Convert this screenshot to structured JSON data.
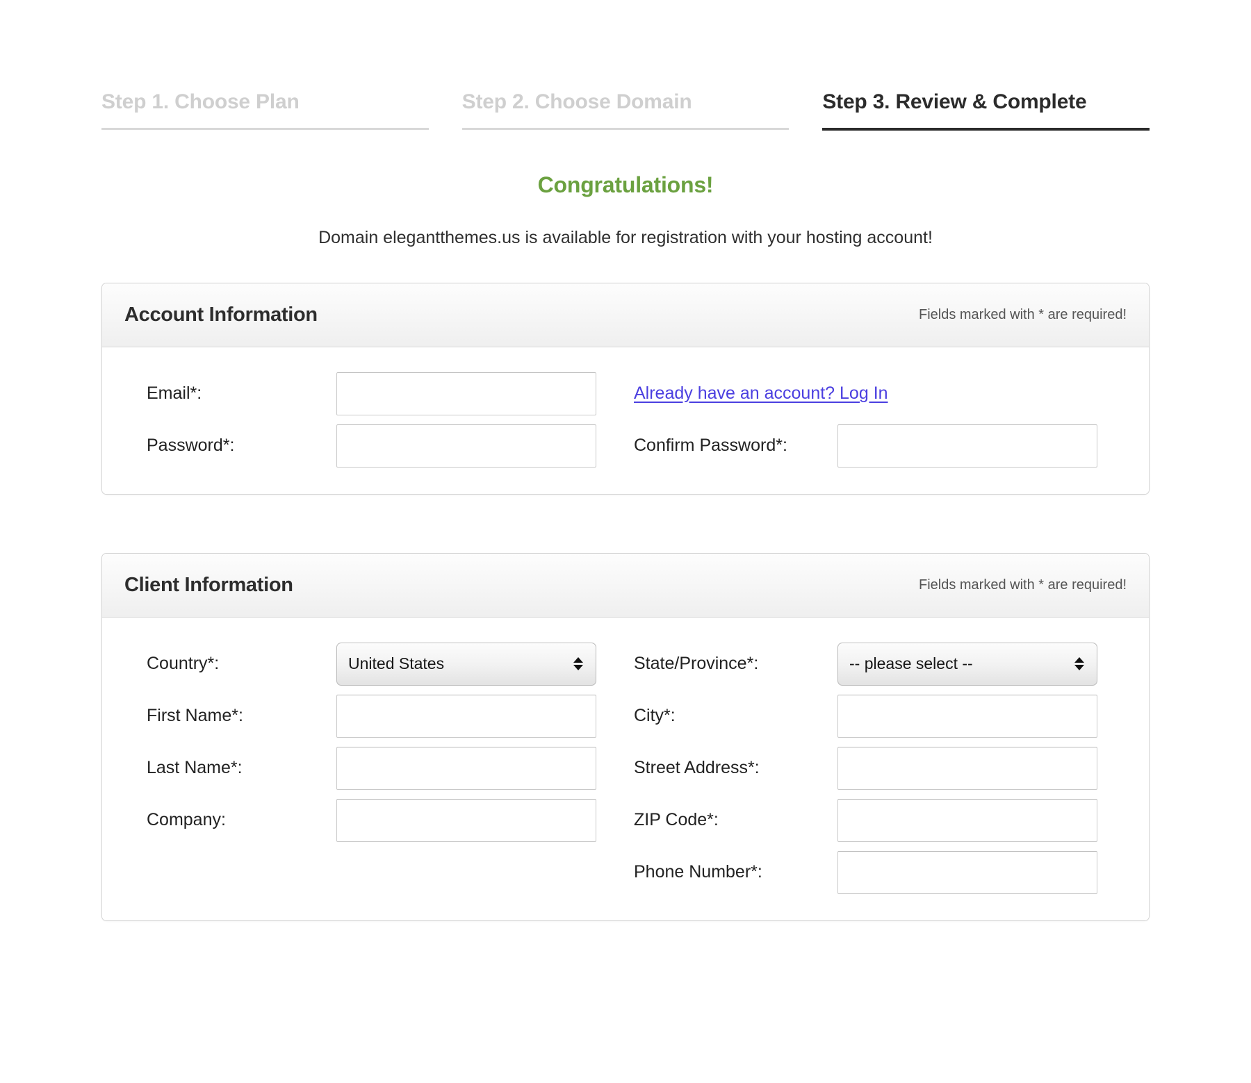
{
  "steps": [
    {
      "label": "Step 1. Choose Plan",
      "state": "inactive"
    },
    {
      "label": "Step 2. Choose Domain",
      "state": "inactive"
    },
    {
      "label": "Step 3. Review & Complete",
      "state": "active"
    }
  ],
  "headline": {
    "congrats": "Congratulations!",
    "availability": "Domain elegantthemes.us is available for registration with your hosting account!"
  },
  "colors": {
    "congrats_green": "#6ba140",
    "link_blue": "#4b3fe0",
    "active_step": "#2b2b2b",
    "inactive_step": "#cfcfcf"
  },
  "account_panel": {
    "title": "Account Information",
    "note": "Fields marked with * are required!",
    "fields": {
      "email_label": "Email*:",
      "email_value": "",
      "email_placeholder": "",
      "password_label": "Password*:",
      "password_value": "",
      "password_placeholder": "",
      "confirm_password_label": "Confirm Password*:",
      "confirm_password_value": "",
      "confirm_password_placeholder": ""
    },
    "login_link": "Already have an account? Log In"
  },
  "client_panel": {
    "title": "Client Information",
    "note": "Fields marked with * are required!",
    "fields": {
      "country_label": "Country*:",
      "country_value": "United States",
      "state_label": "State/Province*:",
      "state_value": "-- please select --",
      "first_name_label": "First Name*:",
      "first_name_value": "",
      "first_name_placeholder": "",
      "city_label": "City*:",
      "city_value": "",
      "city_placeholder": "",
      "last_name_label": "Last Name*:",
      "last_name_value": "",
      "last_name_placeholder": "",
      "street_label": "Street Address*:",
      "street_value": "",
      "street_placeholder": "",
      "company_label": "Company:",
      "company_value": "",
      "company_placeholder": "",
      "zip_label": "ZIP Code*:",
      "zip_value": "",
      "zip_placeholder": "",
      "phone_label": "Phone Number*:",
      "phone_value": "",
      "phone_placeholder": ""
    }
  }
}
